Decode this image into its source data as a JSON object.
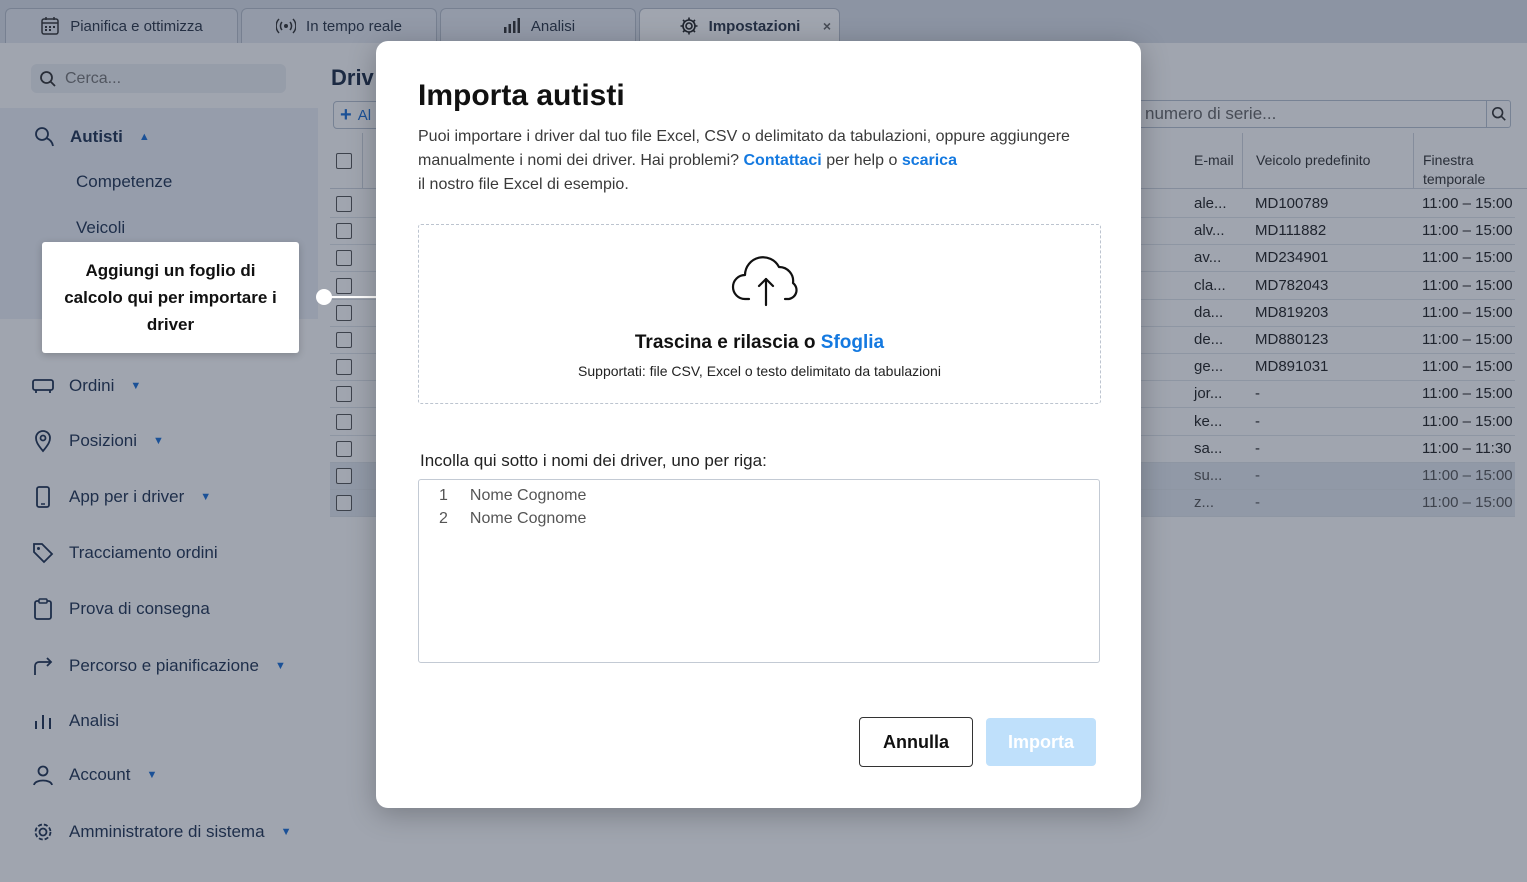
{
  "tabs": [
    {
      "label": "Pianifica e ottimizza",
      "icon": "calendar-icon"
    },
    {
      "label": "In tempo reale",
      "icon": "broadcast-icon"
    },
    {
      "label": "Analisi",
      "icon": "bar-chart-icon"
    },
    {
      "label": "Impostazioni",
      "icon": "gear-icon",
      "active": true,
      "close": "×"
    }
  ],
  "sidebar": {
    "search_placeholder": "Cerca...",
    "section": {
      "label": "Autisti",
      "expanded": true
    },
    "subitems": [
      "Competenze",
      "Veicoli"
    ],
    "items": [
      {
        "label": "Ordini",
        "icon": "truck-icon",
        "dropdown": true
      },
      {
        "label": "Posizioni",
        "icon": "location-pin-icon",
        "dropdown": true
      },
      {
        "label": "App per i driver",
        "icon": "smartphone-icon",
        "dropdown": true
      },
      {
        "label": "Tracciamento ordini",
        "icon": "tag-icon",
        "dropdown": false
      },
      {
        "label": "Prova di consegna",
        "icon": "clipboard-icon",
        "dropdown": false
      },
      {
        "label": "Percorso e pianificazione",
        "icon": "route-arrow-icon",
        "dropdown": true
      },
      {
        "label": "Analisi",
        "icon": "bar-chart-icon",
        "dropdown": false
      },
      {
        "label": "Account",
        "icon": "user-icon",
        "dropdown": true
      },
      {
        "label": "Amministratore di sistema",
        "icon": "gear-icon",
        "dropdown": true
      }
    ]
  },
  "callout": {
    "text": "Aggiungi un foglio di calcolo qui per importare i driver"
  },
  "main": {
    "title": "Driv",
    "add_label": "Al",
    "search_placeholder": "numero di serie...",
    "columns": [
      "E-mail",
      "Veicolo predefinito",
      "Finestra temporale"
    ],
    "rows": [
      {
        "email": "ale...",
        "vehicle": "MD100789",
        "window": "11:00 – 15:00"
      },
      {
        "email": "alv...",
        "vehicle": "MD111882",
        "window": "11:00 – 15:00"
      },
      {
        "email": "av...",
        "vehicle": "MD234901",
        "window": "11:00 – 15:00"
      },
      {
        "email": "cla...",
        "vehicle": "MD782043",
        "window": "11:00 – 15:00"
      },
      {
        "email": "da...",
        "vehicle": "MD819203",
        "window": "11:00 – 15:00"
      },
      {
        "email": "de...",
        "vehicle": "MD880123",
        "window": "11:00 – 15:00"
      },
      {
        "email": "ge...",
        "vehicle": "MD891031",
        "window": "11:00 – 15:00"
      },
      {
        "email": "jor...",
        "vehicle": "-",
        "window": "11:00 – 15:00"
      },
      {
        "email": "ke...",
        "vehicle": "-",
        "window": "11:00 – 15:00"
      },
      {
        "email": "sa...",
        "vehicle": "-",
        "window": "11:00 – 11:30"
      },
      {
        "email": "su...",
        "vehicle": "-",
        "window": "11:00 – 15:00"
      },
      {
        "email": "z...",
        "vehicle": "-",
        "window": "11:00 – 15:00"
      }
    ]
  },
  "modal": {
    "title": "Importa autisti",
    "desc_part1": "Puoi importare i driver dal tuo file Excel, CSV o delimitato da tabulazioni, oppure aggiungere manualmente i nomi dei driver. Hai problemi?",
    "desc_link1": "Contattaci",
    "desc_part2": "per help o",
    "desc_link2": "scarica",
    "desc_part3": "il nostro file Excel di esempio.",
    "dropzone_text": "Trascina e rilascia o",
    "dropzone_link": "Sfoglia",
    "dropzone_supported": "Supportati: file CSV, Excel o testo delimitato da tabulazioni",
    "paste_label": "Incolla qui sotto i nomi dei driver, uno per riga:",
    "placeholder_lines": [
      {
        "num": "1",
        "text": "Nome Cognome"
      },
      {
        "num": "2",
        "text": "Nome Cognome"
      }
    ],
    "cancel_label": "Annulla",
    "import_label": "Importa"
  },
  "colors": {
    "accent": "#1479e0",
    "import_disabled": "#bfe0fb",
    "overlay": "#1c2840"
  }
}
